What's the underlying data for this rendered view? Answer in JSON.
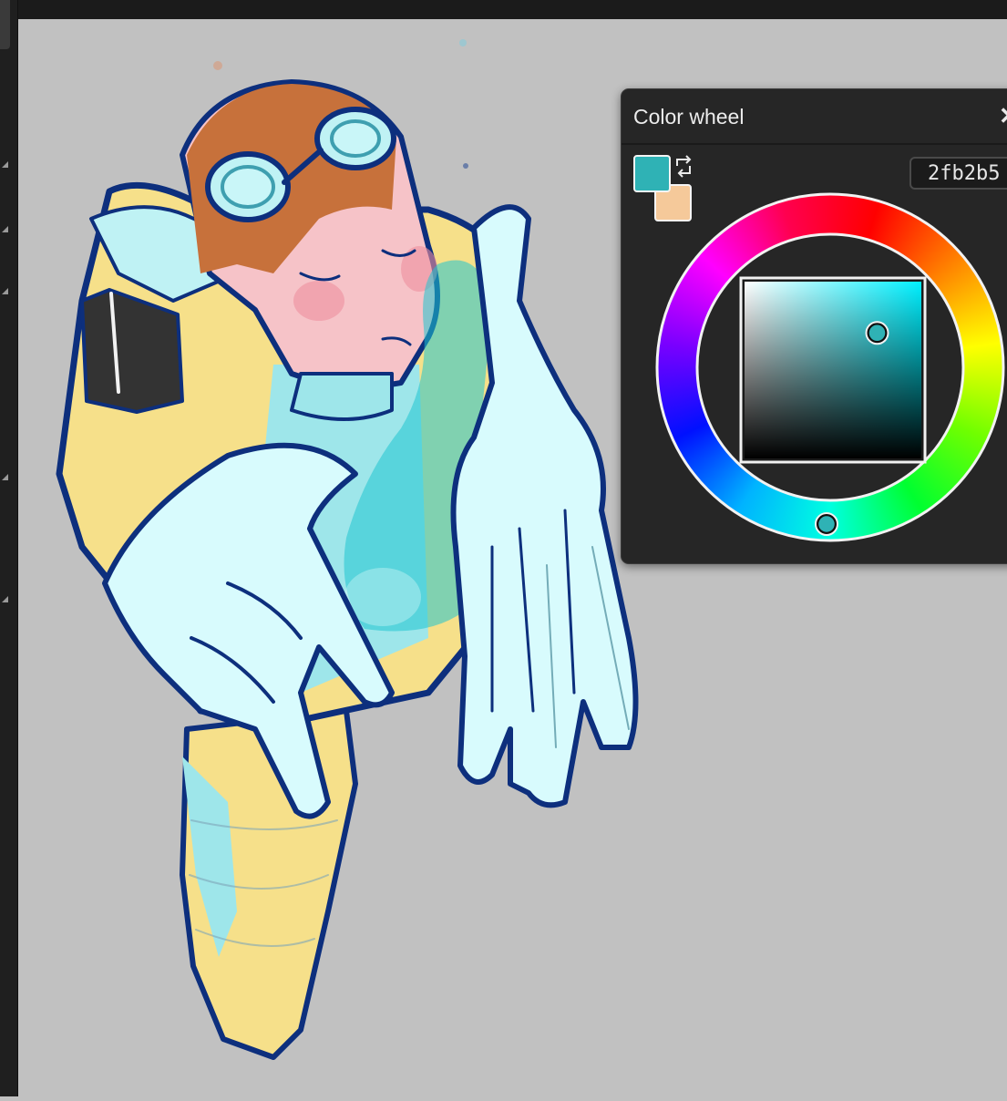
{
  "panel": {
    "title": "Color wheel",
    "close_glyph": "✕",
    "hex_value": "2fb2b5",
    "primary_color": "#2fb2b5",
    "secondary_color": "#f5c99a",
    "swap_icon": "swap-arrows-icon"
  },
  "picker": {
    "hue_color": "#00f0ff",
    "hue_marker_color": "#2fb2b5",
    "saturation": 0.75,
    "value": 0.71
  },
  "canvas": {
    "background": "#c1c1c1"
  }
}
